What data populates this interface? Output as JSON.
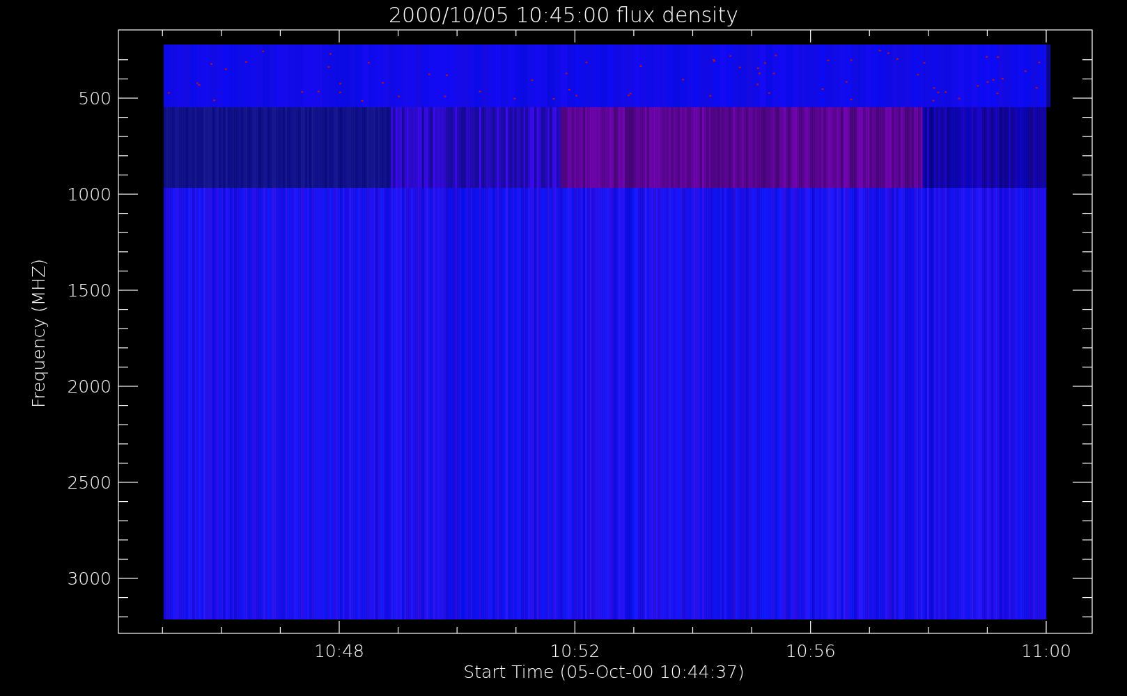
{
  "plot": {
    "title": "2000/10/05 10:45:00 flux density",
    "xlabel": "Start Time (05-Oct-00 10:44:37)",
    "ylabel": "Frequency (MHZ)",
    "xtick_labels": [
      "10:48",
      "10:52",
      "10:56",
      "11:00"
    ],
    "ytick_labels": [
      "500",
      "1000",
      "1500",
      "2000",
      "2500",
      "3000"
    ]
  }
}
